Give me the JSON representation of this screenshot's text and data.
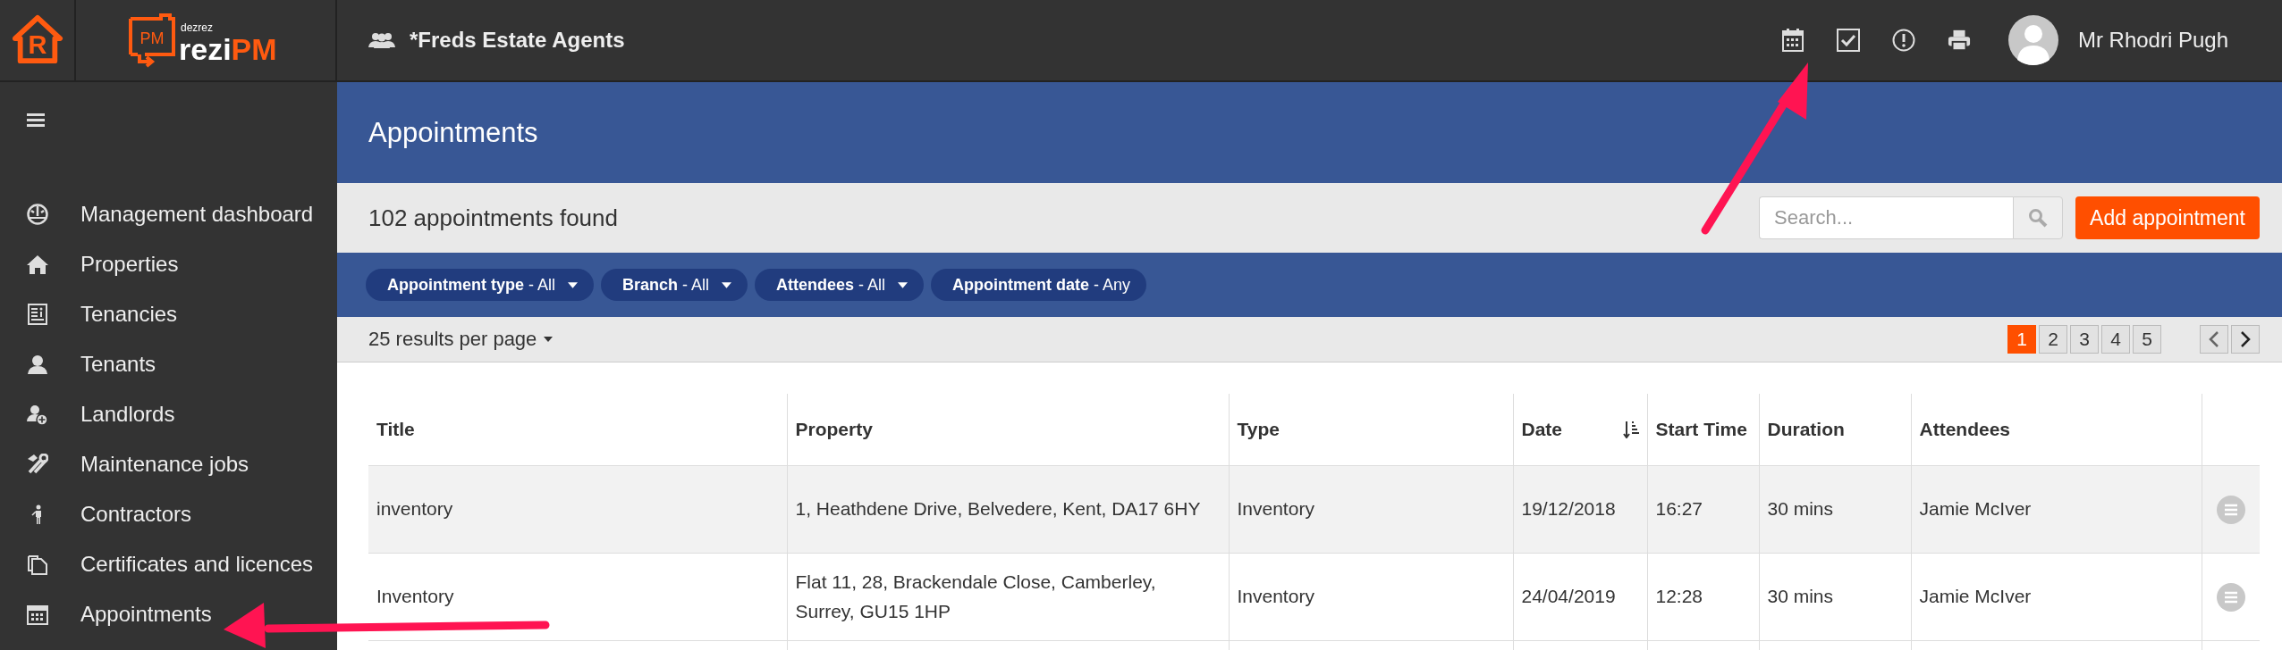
{
  "logo": {
    "mark": "R",
    "badge": "PM",
    "maker": "dezrez",
    "name": "rezi",
    "suffix": "PM"
  },
  "header": {
    "organisation": "*Freds Estate Agents",
    "user": "Mr Rhodri Pugh"
  },
  "sidebar": {
    "items": [
      {
        "label": "Management dashboard"
      },
      {
        "label": "Properties"
      },
      {
        "label": "Tenancies"
      },
      {
        "label": "Tenants"
      },
      {
        "label": "Landlords"
      },
      {
        "label": "Maintenance jobs"
      },
      {
        "label": "Contractors"
      },
      {
        "label": "Certificates and licences"
      },
      {
        "label": "Appointments"
      }
    ]
  },
  "page": {
    "title": "Appointments",
    "count": "102 appointments found",
    "search": {
      "placeholder": "Search..."
    },
    "add_button": "Add appointment"
  },
  "filters": [
    {
      "name": "Appointment type",
      "value": "- All",
      "dropdown": true
    },
    {
      "name": "Branch",
      "value": "- All",
      "dropdown": true
    },
    {
      "name": "Attendees",
      "value": "- All",
      "dropdown": true
    },
    {
      "name": "Appointment date",
      "value": "- Any",
      "dropdown": false
    }
  ],
  "per_page": "25 results per page",
  "pagination": [
    {
      "label": "1",
      "selected": true
    },
    {
      "label": "2",
      "selected": false
    },
    {
      "label": "3",
      "selected": false
    },
    {
      "label": "4",
      "selected": false
    },
    {
      "label": "5",
      "selected": false
    }
  ],
  "table": {
    "columns": [
      {
        "label": "Title",
        "sorted": false
      },
      {
        "label": "Property",
        "sorted": false
      },
      {
        "label": "Type",
        "sorted": false
      },
      {
        "label": "Date",
        "sorted": true
      },
      {
        "label": "Start Time",
        "sorted": false
      },
      {
        "label": "Duration",
        "sorted": false
      },
      {
        "label": "Attendees",
        "sorted": false
      }
    ],
    "rows": [
      {
        "cells": [
          "inventory",
          "1, Heathdene Drive, Belvedere, Kent, DA17 6HY",
          "Inventory",
          "19/12/2018",
          "16:27",
          "30 mins",
          "Jamie McIver"
        ]
      },
      {
        "cells": [
          "Inventory",
          "Flat 11, 28, Brackendale Close, Camberley, Surrey, GU15 1HP",
          "Inventory",
          "24/04/2019",
          "12:28",
          "30 mins",
          "Jamie McIver"
        ]
      }
    ]
  }
}
